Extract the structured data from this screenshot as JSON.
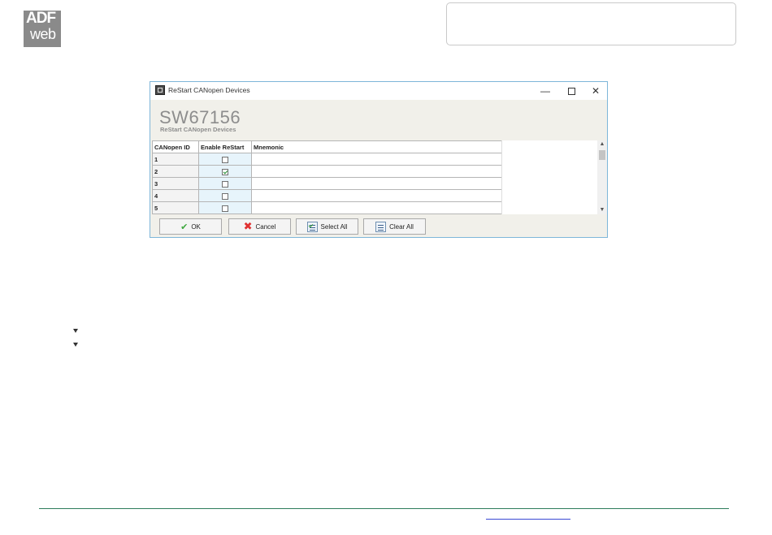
{
  "header": {
    "logo_line1": "ADF",
    "logo_line2": "web"
  },
  "window": {
    "title": "ReStart CANopen Devices",
    "app_code": "SW67156",
    "subtitle": "ReStart CANopen Devices",
    "controls": {
      "minimize": "—",
      "maximize": "",
      "close": "✕"
    },
    "grid": {
      "columns": [
        "CANopen ID",
        "Enable ReStart",
        "Mnemonic"
      ],
      "rows": [
        {
          "id": "1",
          "enabled": false,
          "mnemonic": ""
        },
        {
          "id": "2",
          "enabled": true,
          "mnemonic": ""
        },
        {
          "id": "3",
          "enabled": false,
          "mnemonic": ""
        },
        {
          "id": "4",
          "enabled": false,
          "mnemonic": ""
        },
        {
          "id": "5",
          "enabled": false,
          "mnemonic": ""
        }
      ]
    },
    "buttons": {
      "ok": "OK",
      "cancel": "Cancel",
      "select_all": "Select All",
      "clear_all": "Clear All"
    }
  },
  "icons": {
    "ok": "checkmark-icon",
    "cancel": "red-x-icon",
    "select_all": "list-checked-icon",
    "clear_all": "list-icon"
  },
  "colors": {
    "window_border": "#7eb6d9",
    "check_column": "#e7f4fb",
    "footer_rule": "#2e7d5b",
    "link": "#3a48d4"
  }
}
